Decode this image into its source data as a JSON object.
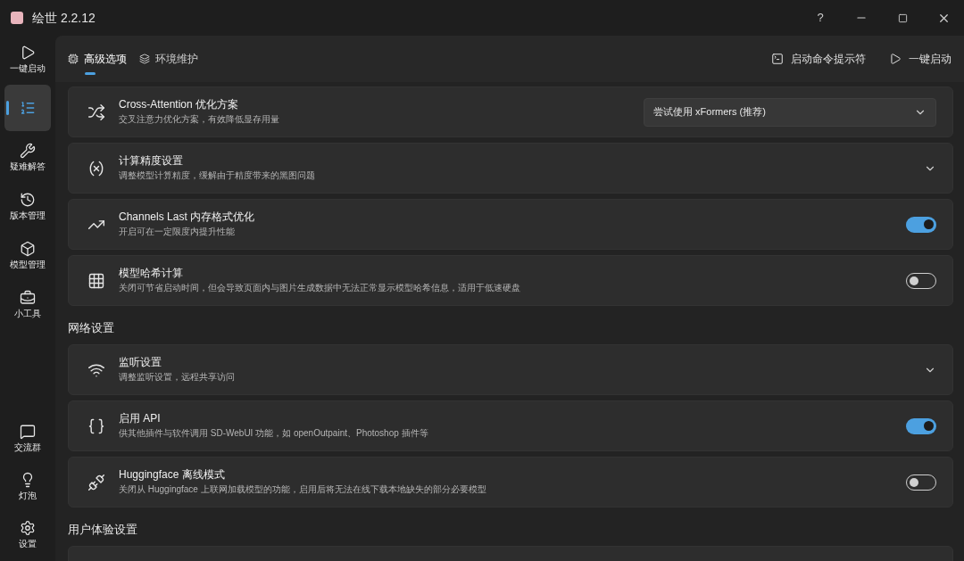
{
  "window": {
    "title": "绘世 2.2.12",
    "help": "?"
  },
  "sidebar": {
    "items": [
      {
        "label": "一键启动",
        "selected": false
      },
      {
        "selected": true
      },
      {
        "label": "疑难解答",
        "selected": false
      },
      {
        "label": "版本管理",
        "selected": false
      },
      {
        "label": "模型管理",
        "selected": false
      },
      {
        "label": "小工具",
        "selected": false
      }
    ],
    "bottom_items": [
      {
        "label": "交流群",
        "selected": false
      },
      {
        "label": "灯泡",
        "selected": false
      },
      {
        "label": "设置",
        "selected": false
      }
    ]
  },
  "tabs": [
    {
      "label": "高级选项",
      "selected": true
    },
    {
      "label": "环境维护",
      "selected": false
    }
  ],
  "actions": [
    {
      "label": "启动命令提示符"
    },
    {
      "label": "一键启动"
    }
  ],
  "sections": [
    {
      "cards": [
        {
          "kind": "dropdown",
          "title": "Cross-Attention 优化方案",
          "description": "交叉注意力优化方案，有效降低显存用量",
          "value": "尝试使用 xFormers (推荐)"
        },
        {
          "kind": "expander",
          "title": "计算精度设置",
          "description": "调整模型计算精度，缓解由于精度带来的黑图问题"
        },
        {
          "kind": "toggle",
          "title": "Channels Last 内存格式优化",
          "description": "开启可在一定限度内提升性能",
          "on": true
        },
        {
          "kind": "toggle",
          "title": "模型哈希计算",
          "description": "关闭可节省启动时间，但会导致页面内与图片生成数据中无法正常显示模型哈希信息，适用于低速硬盘",
          "on": false
        }
      ]
    },
    {
      "heading": "网络设置",
      "cards": [
        {
          "kind": "expander",
          "title": "监听设置",
          "description": "调整监听设置，远程共享访问"
        },
        {
          "kind": "toggle",
          "title": "启用 API",
          "description": "供其他插件与软件调用 SD-WebUI 功能，如 openOutpaint、Photoshop 插件等",
          "on": true
        },
        {
          "kind": "toggle",
          "title": "Huggingface 离线模式",
          "description": "关闭从 Huggingface 上联网加载模型的功能，启用后将无法在线下载本地缺失的部分必要模型",
          "on": false
        }
      ]
    },
    {
      "heading": "用户体验设置",
      "cards": [
        {
          "kind": "partial"
        }
      ]
    }
  ]
}
